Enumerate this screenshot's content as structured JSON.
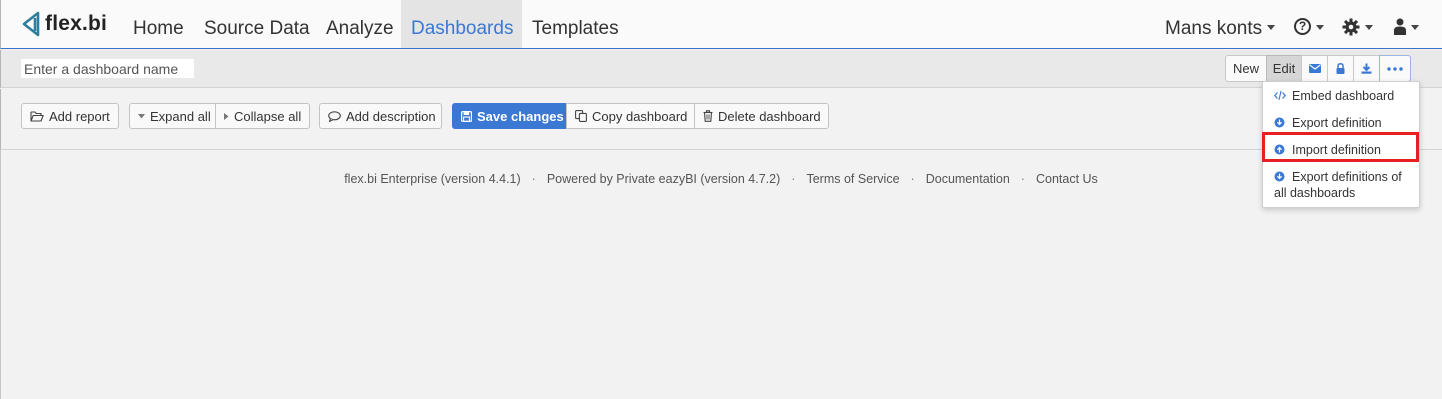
{
  "app": {
    "logo_text": "flex.bi"
  },
  "nav": {
    "items": [
      {
        "label": "Home"
      },
      {
        "label": "Source Data"
      },
      {
        "label": "Analyze"
      },
      {
        "label": "Dashboards"
      },
      {
        "label": "Templates"
      }
    ],
    "active": "Dashboards",
    "account_label": "Mans konts",
    "help_glyph": "?"
  },
  "dashboard": {
    "name_placeholder": "Enter a dashboard name",
    "name_value": ""
  },
  "top_toolbar": {
    "new_label": "New",
    "edit_label": "Edit"
  },
  "toolbar": {
    "add_report": "Add report",
    "expand_all": "Expand all",
    "collapse_all": "Collapse all",
    "add_description": "Add description",
    "save_changes": "Save changes",
    "copy_dashboard": "Copy dashboard",
    "delete_dashboard": "Delete dashboard"
  },
  "menu": {
    "items": [
      {
        "label": "Embed dashboard",
        "icon": "code-icon"
      },
      {
        "label": "Export definition",
        "icon": "arrow-circle-icon"
      },
      {
        "label": "Import definition",
        "icon": "arrow-circle-icon",
        "highlighted": true
      },
      {
        "label_line1": "Export definitions of",
        "label_line2": "all dashboards",
        "icon": "arrow-circle-icon"
      }
    ]
  },
  "footer": {
    "edition": "flex.bi Enterprise (version 4.4.1)",
    "powered_by": "Powered by Private eazyBI (version 4.7.2)",
    "terms": "Terms of Service",
    "docs": "Documentation",
    "contact": "Contact Us",
    "separator": "·"
  },
  "colors": {
    "accent": "#3a78d4",
    "highlight": "#e62020",
    "nav_bg": "#fafafa",
    "page_bg": "#f2f2f2"
  }
}
